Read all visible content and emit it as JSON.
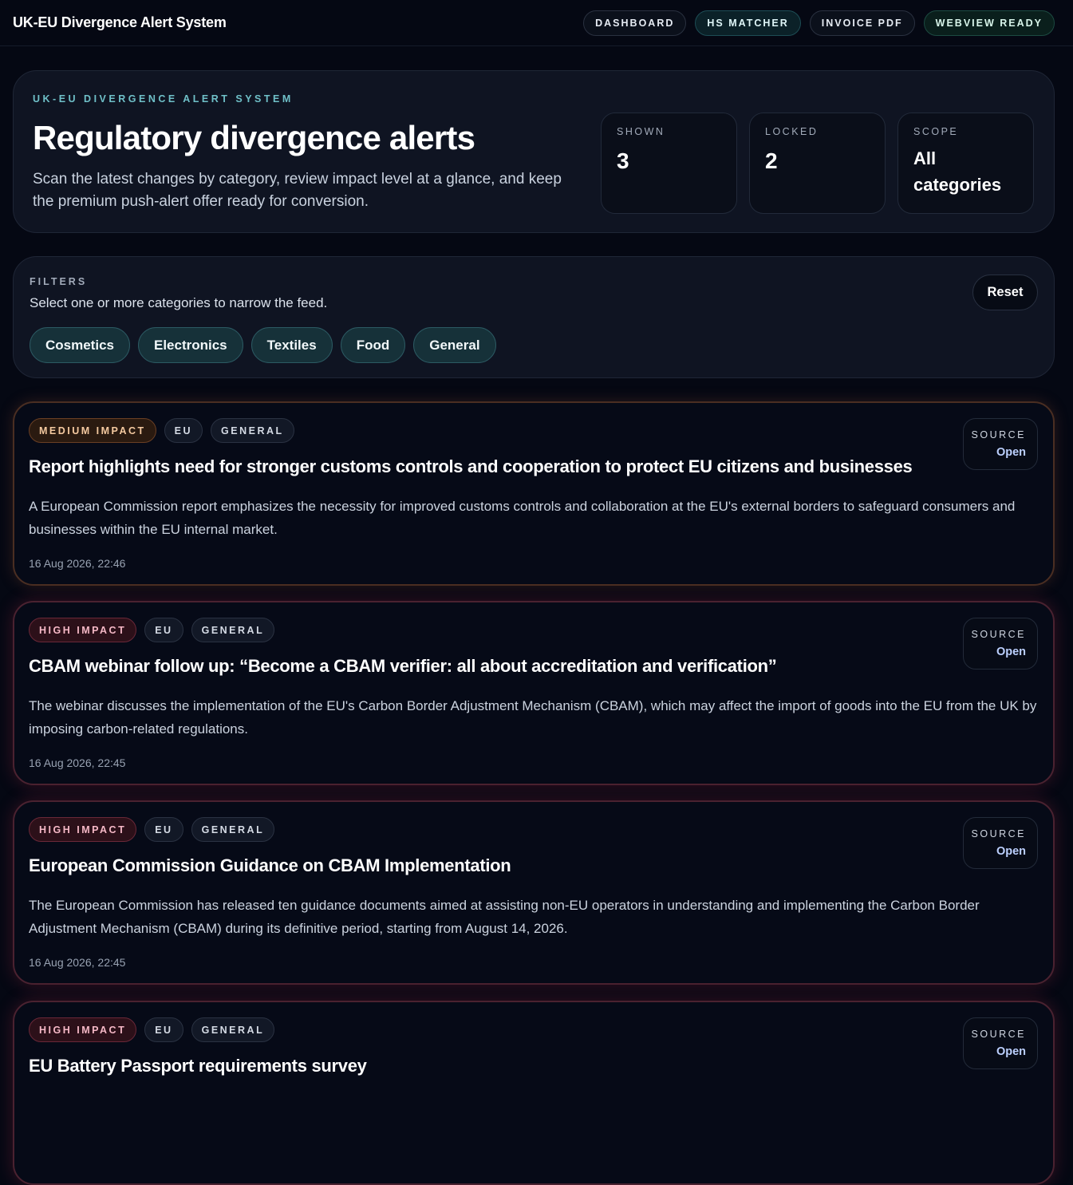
{
  "app": {
    "title": "UK-EU Divergence Alert System"
  },
  "nav": [
    {
      "label": "DASHBOARD"
    },
    {
      "label": "HS MATCHER"
    },
    {
      "label": "INVOICE PDF"
    },
    {
      "label": "WEBVIEW READY"
    }
  ],
  "hero": {
    "eyebrow": "UK-EU DIVERGENCE ALERT SYSTEM",
    "title": "Regulatory divergence alerts",
    "description": "Scan the latest changes by category, review impact level at a glance, and keep the premium push-alert offer ready for conversion.",
    "stats": [
      {
        "label": "SHOWN",
        "value": "3"
      },
      {
        "label": "LOCKED",
        "value": "2"
      },
      {
        "label": "SCOPE",
        "value": "All categories"
      }
    ]
  },
  "filters": {
    "label": "FILTERS",
    "hint": "Select one or more categories to narrow the feed.",
    "reset_label": "Reset",
    "categories": [
      "Cosmetics",
      "Electronics",
      "Textiles",
      "Food",
      "General"
    ]
  },
  "alerts": [
    {
      "impact": "MEDIUM IMPACT",
      "region": "EU",
      "category": "GENERAL",
      "title": "Report highlights need for stronger customs controls and cooperation to protect EU citizens and businesses",
      "summary": "A European Commission report emphasizes the necessity for improved customs controls and collaboration at the EU's external borders to safeguard consumers and businesses within the EU internal market.",
      "date": "16 Aug 2026, 22:46",
      "source_label": "SOURCE",
      "source_link": "Open"
    },
    {
      "impact": "HIGH IMPACT",
      "region": "EU",
      "category": "GENERAL",
      "title": "CBAM webinar follow up: “Become a CBAM verifier: all about accreditation and verification”",
      "summary": "The webinar discusses the implementation of the EU's Carbon Border Adjustment Mechanism (CBAM), which may affect the import of goods into the EU from the UK by imposing carbon-related regulations.",
      "date": "16 Aug 2026, 22:45",
      "source_label": "SOURCE",
      "source_link": "Open"
    },
    {
      "impact": "HIGH IMPACT",
      "region": "EU",
      "category": "GENERAL",
      "title": "European Commission Guidance on CBAM Implementation",
      "summary": "The European Commission has released ten guidance documents aimed at assisting non-EU operators in understanding and implementing the Carbon Border Adjustment Mechanism (CBAM) during its definitive period, starting from August 14, 2026.",
      "date": "16 Aug 2026, 22:45",
      "source_label": "SOURCE",
      "source_link": "Open"
    },
    {
      "impact": "HIGH IMPACT",
      "region": "EU",
      "category": "GENERAL",
      "title": "EU Battery Passport requirements survey",
      "summary": "",
      "date": "",
      "source_label": "SOURCE",
      "source_link": "Open"
    }
  ]
}
